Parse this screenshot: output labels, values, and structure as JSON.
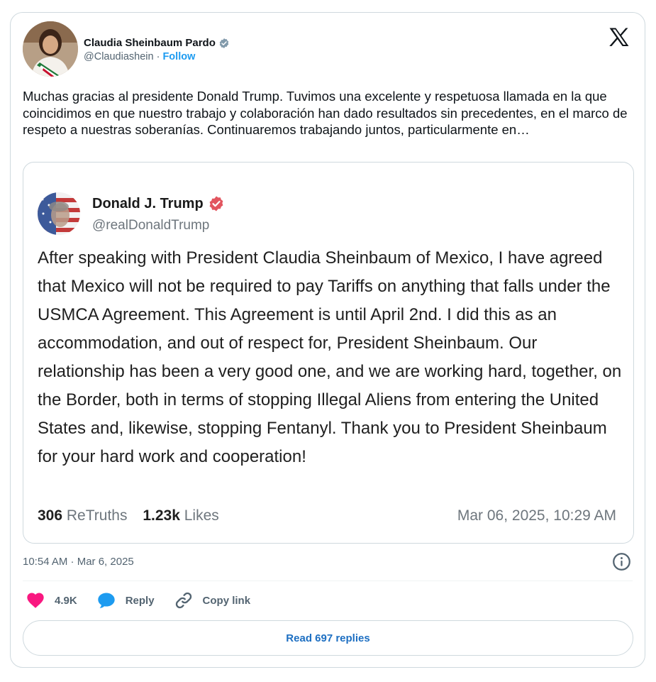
{
  "tweet": {
    "author": {
      "name": "Claudia Sheinbaum Pardo",
      "handle": "@Claudiashein",
      "separator": " · ",
      "follow_label": "Follow"
    },
    "text": "Muchas gracias al presidente Donald Trump. Tuvimos una excelente y respetuosa llamada en la que coincidimos en que nuestro trabajo y colaboración han dado resultados sin precedentes, en el marco de respeto a nuestras soberanías. Continuaremos trabajando juntos, particularmente en…",
    "timestamp": "10:54 AM · Mar 6, 2025",
    "actions": {
      "likes_count": "4.9K",
      "reply_label": "Reply",
      "copy_link_label": "Copy link"
    },
    "read_replies_label": "Read 697 replies"
  },
  "quoted_post": {
    "author_name": "Donald J. Trump",
    "author_handle": "@realDonaldTrump",
    "body": "After speaking with President Claudia Sheinbaum of Mexico, I have agreed that Mexico will not be required to pay Tariffs on anything that falls under the USMCA Agreement. This Agreement is until April 2nd. I did this as an accommodation, and out of respect for, President Sheinbaum. Our relationship has been a very good one, and we are working hard, together, on the Border, both in terms of stopping Illegal Aliens from entering the United States and, likewise, stopping Fentanyl. Thank you to President Sheinbaum for your hard work and cooperation!",
    "retruths_count": "306",
    "retruths_label": "ReTruths",
    "likes_count": "1.23k",
    "likes_label": "Likes",
    "date": "Mar 06, 2025, 10:29 AM"
  },
  "colors": {
    "accent": "#1d9bf0",
    "like": "#f91880",
    "reply": "#1d9bf0",
    "truth_verified": "#e2555f"
  },
  "icons": [
    "x-logo-icon",
    "verified-badge-icon",
    "truth-verified-icon",
    "info-icon",
    "heart-icon",
    "reply-bubble-icon",
    "link-icon"
  ]
}
